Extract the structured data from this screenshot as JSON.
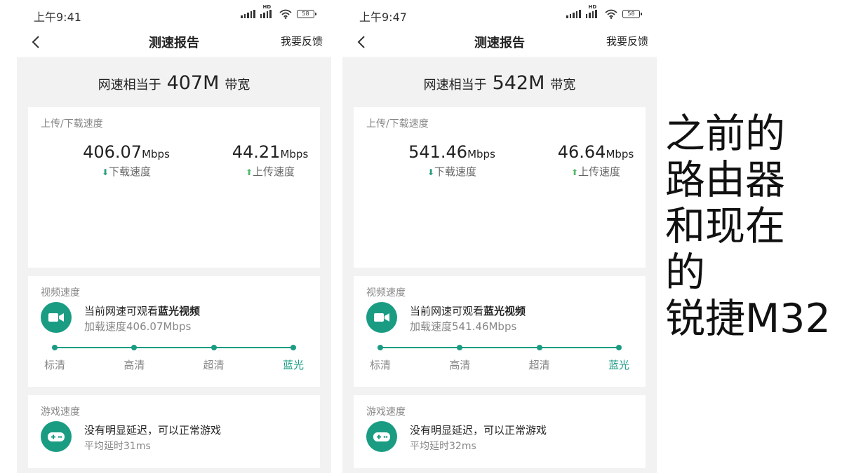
{
  "phones": [
    {
      "status": {
        "time": "上午9:41",
        "battery": "58"
      },
      "nav": {
        "title": "测速报告",
        "feedback": "我要反馈"
      },
      "summary": {
        "prefix": "网速相当于",
        "value": "407M",
        "suffix": "带宽"
      },
      "speed": {
        "label": "上传/下载速度",
        "download": {
          "value": "406.07",
          "unit": "Mbps",
          "label": "下载速度"
        },
        "upload": {
          "value": "44.21",
          "unit": "Mbps",
          "label": "上传速度"
        }
      },
      "video": {
        "label": "视频速度",
        "line1_prefix": "当前网速可观看",
        "line1_bold": "蓝光视频",
        "line2": "加载速度406.07Mbps",
        "levels": [
          "标清",
          "高清",
          "超清",
          "蓝光"
        ],
        "active_level": "蓝光"
      },
      "game": {
        "label": "游戏速度",
        "line1": "没有明显延迟，可以正常游戏",
        "line2": "平均延时31ms"
      }
    },
    {
      "status": {
        "time": "上午9:47",
        "battery": "58"
      },
      "nav": {
        "title": "测速报告",
        "feedback": "我要反馈"
      },
      "summary": {
        "prefix": "网速相当于",
        "value": "542M",
        "suffix": "带宽"
      },
      "speed": {
        "label": "上传/下载速度",
        "download": {
          "value": "541.46",
          "unit": "Mbps",
          "label": "下载速度"
        },
        "upload": {
          "value": "46.64",
          "unit": "Mbps",
          "label": "上传速度"
        }
      },
      "video": {
        "label": "视频速度",
        "line1_prefix": "当前网速可观看",
        "line1_bold": "蓝光视频",
        "line2": "加载速度541.46Mbps",
        "levels": [
          "标清",
          "高清",
          "超清",
          "蓝光"
        ],
        "active_level": "蓝光"
      },
      "game": {
        "label": "游戏速度",
        "line1": "没有明显延迟，可以正常游戏",
        "line2": "平均延时32ms"
      }
    }
  ],
  "caption": {
    "lines": [
      "之前的",
      "路由器",
      "和现在",
      "的",
      "锐捷M32"
    ]
  },
  "colors": {
    "accent": "#1a9c83",
    "background": "#f2f2f2",
    "upload_arrow": "#55b86b"
  },
  "icons": {
    "back": "chevron-left-icon",
    "video": "video-camera-icon",
    "game": "gamepad-icon",
    "download": "arrow-down-icon",
    "upload": "arrow-up-icon"
  }
}
